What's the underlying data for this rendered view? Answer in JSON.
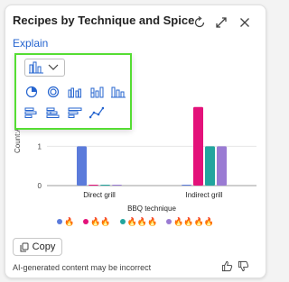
{
  "header": {
    "title": "Recipes by Technique and Spice",
    "explain_label": "Explain"
  },
  "chart_data": {
    "type": "bar",
    "xlabel": "BBQ technique",
    "ylabel": "Count:All (r",
    "categories": [
      "Direct grill",
      "Indirect grill"
    ],
    "y_ticks": [
      "0",
      "1"
    ],
    "ylim": [
      0,
      2.2
    ],
    "series": [
      {
        "name": "🔥",
        "color": "#5b7bdb",
        "values": [
          1,
          0
        ]
      },
      {
        "name": "🔥🔥",
        "color": "#e3127a",
        "values": [
          0,
          2
        ]
      },
      {
        "name": "🔥🔥🔥",
        "color": "#22a59e",
        "values": [
          0,
          1
        ]
      },
      {
        "name": "🔥🔥🔥🔥",
        "color": "#9a7bd3",
        "values": [
          0,
          1
        ]
      }
    ]
  },
  "popover": {
    "chart_types": [
      "column-chart-icon",
      "pie-chart-icon",
      "donut-chart-icon",
      "clustered-column-icon",
      "stacked-column-icon",
      "column-100-icon",
      "bar-chart-icon",
      "stacked-bar-icon",
      "bar-100-icon",
      "line-chart-icon"
    ]
  },
  "footer": {
    "copy_label": "Copy",
    "disclaimer": "AI-generated content may be incorrect"
  },
  "colors": {
    "accent": "#2564cf",
    "highlight": "#55dd33"
  }
}
